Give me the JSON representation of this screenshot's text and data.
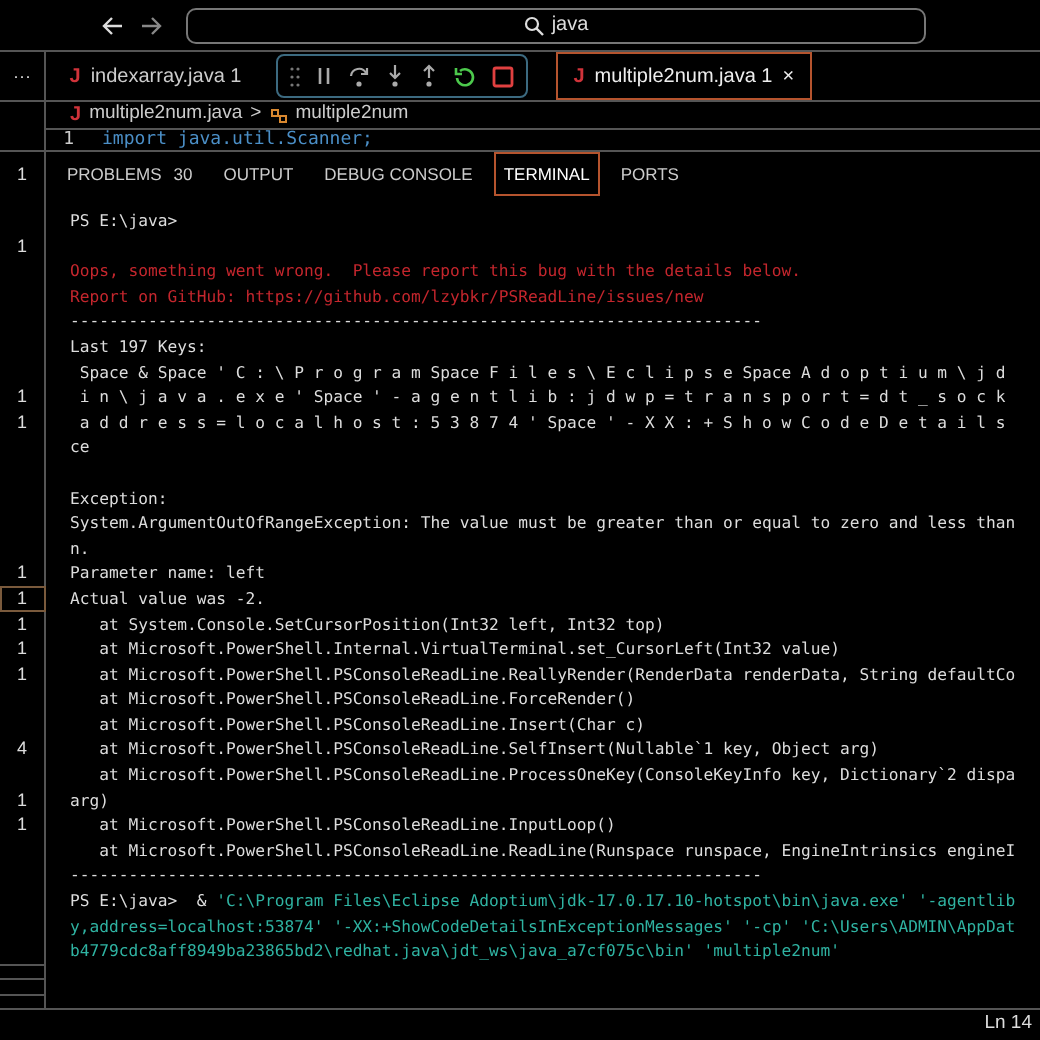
{
  "nav": {
    "search": "java"
  },
  "overflow": "···",
  "editor_tabs": [
    {
      "icon": "J",
      "label": "indexarray.java",
      "badge": "1",
      "selected": false
    },
    {
      "icon": "J",
      "label": "multiple2num.java",
      "badge": "1",
      "selected": true,
      "close": "×"
    }
  ],
  "breadcrumb": {
    "icon": "J",
    "file": "multiple2num.java",
    "separator": ">",
    "symbol": "multiple2num"
  },
  "code": [
    {
      "number": "1",
      "text": "import java.util.Scanner;"
    }
  ],
  "panel_gutter": "1",
  "panel_tabs": [
    {
      "label": "PROBLEMS",
      "count": "30",
      "selected": false
    },
    {
      "label": "OUTPUT",
      "selected": false
    },
    {
      "label": "DEBUG CONSOLE",
      "selected": false
    },
    {
      "label": "TERMINAL",
      "selected": true
    },
    {
      "label": "PORTS",
      "selected": false
    }
  ],
  "terminal": [
    {
      "kind": "plain",
      "text": "PS E:\\java>"
    },
    {
      "kind": "blank",
      "gutter": "1"
    },
    {
      "kind": "error",
      "text": "Oops, something went wrong.  Please report this bug with the details below."
    },
    {
      "kind": "error",
      "text": "Report on GitHub: https://github.com/lzybkr/PSReadLine/issues/new"
    },
    {
      "kind": "plain",
      "text": "-----------------------------------------------------------------------"
    },
    {
      "kind": "plain",
      "text": "Last 197 Keys:"
    },
    {
      "kind": "plain",
      "text": " Space & Space ' C : \\ P r o g r a m Space F i l e s \\ E c l i p s e Space A d o p t i u m \\ j d"
    },
    {
      "kind": "plain",
      "text": " i n \\ j a v a . e x e ' Space ' - a g e n t l i b : j d w p = t r a n s p o r t = d t _ s o c k",
      "gutter": "1"
    },
    {
      "kind": "plain",
      "text": " a d d r e s s = l o c a l h o s t : 5 3 8 7 4 ' Space ' - X X : + S h o w C o d e D e t a i l s",
      "gutter": "1"
    },
    {
      "kind": "plain",
      "text": "ce"
    },
    {
      "kind": "blank"
    },
    {
      "kind": "plain",
      "text": "Exception:"
    },
    {
      "kind": "plain",
      "text": "System.ArgumentOutOfRangeException: The value must be greater than or equal to zero and less than"
    },
    {
      "kind": "plain",
      "text": "n."
    },
    {
      "kind": "plain",
      "text": "Parameter name: left",
      "gutter": "1"
    },
    {
      "kind": "plain",
      "text": "Actual value was -2.",
      "gutter": "1",
      "highlighted": true
    },
    {
      "kind": "plain",
      "text": "   at System.Console.SetCursorPosition(Int32 left, Int32 top)",
      "gutter": "1"
    },
    {
      "kind": "plain",
      "text": "   at Microsoft.PowerShell.Internal.VirtualTerminal.set_CursorLeft(Int32 value)",
      "gutter": "1"
    },
    {
      "kind": "plain",
      "text": "   at Microsoft.PowerShell.PSConsoleReadLine.ReallyRender(RenderData renderData, String defaultCo",
      "gutter": "1"
    },
    {
      "kind": "plain",
      "text": "   at Microsoft.PowerShell.PSConsoleReadLine.ForceRender()"
    },
    {
      "kind": "plain",
      "text": "   at Microsoft.PowerShell.PSConsoleReadLine.Insert(Char c)"
    },
    {
      "kind": "plain",
      "text": "   at Microsoft.PowerShell.PSConsoleReadLine.SelfInsert(Nullable`1 key, Object arg)",
      "gutter": "4"
    },
    {
      "kind": "plain",
      "text": "   at Microsoft.PowerShell.PSConsoleReadLine.ProcessOneKey(ConsoleKeyInfo key, Dictionary`2 dispa"
    },
    {
      "kind": "plain",
      "text": "arg)",
      "gutter": "1"
    },
    {
      "kind": "plain",
      "text": "   at Microsoft.PowerShell.PSConsoleReadLine.InputLoop()",
      "gutter": "1"
    },
    {
      "kind": "plain",
      "text": "   at Microsoft.PowerShell.PSConsoleReadLine.ReadLine(Runspace runspace, EngineIntrinsics engineI"
    },
    {
      "kind": "plain",
      "text": "-----------------------------------------------------------------------"
    },
    {
      "kind": "command",
      "prompt": "PS E:\\java>  & ",
      "text": "'C:\\Program Files\\Eclipse Adoptium\\jdk-17.0.17.10-hotspot\\bin\\java.exe' '-agentlib"
    },
    {
      "kind": "command",
      "text": "y,address=localhost:53874' '-XX:+ShowCodeDetailsInExceptionMessages' '-cp' 'C:\\Users\\ADMIN\\AppDat"
    },
    {
      "kind": "command",
      "text": "b4779cdc8aff8949ba23865bd2\\redhat.java\\jdt_ws\\java_a7cf075c\\bin' 'multiple2num'"
    }
  ],
  "status_bar": {
    "position": "Ln 14"
  }
}
